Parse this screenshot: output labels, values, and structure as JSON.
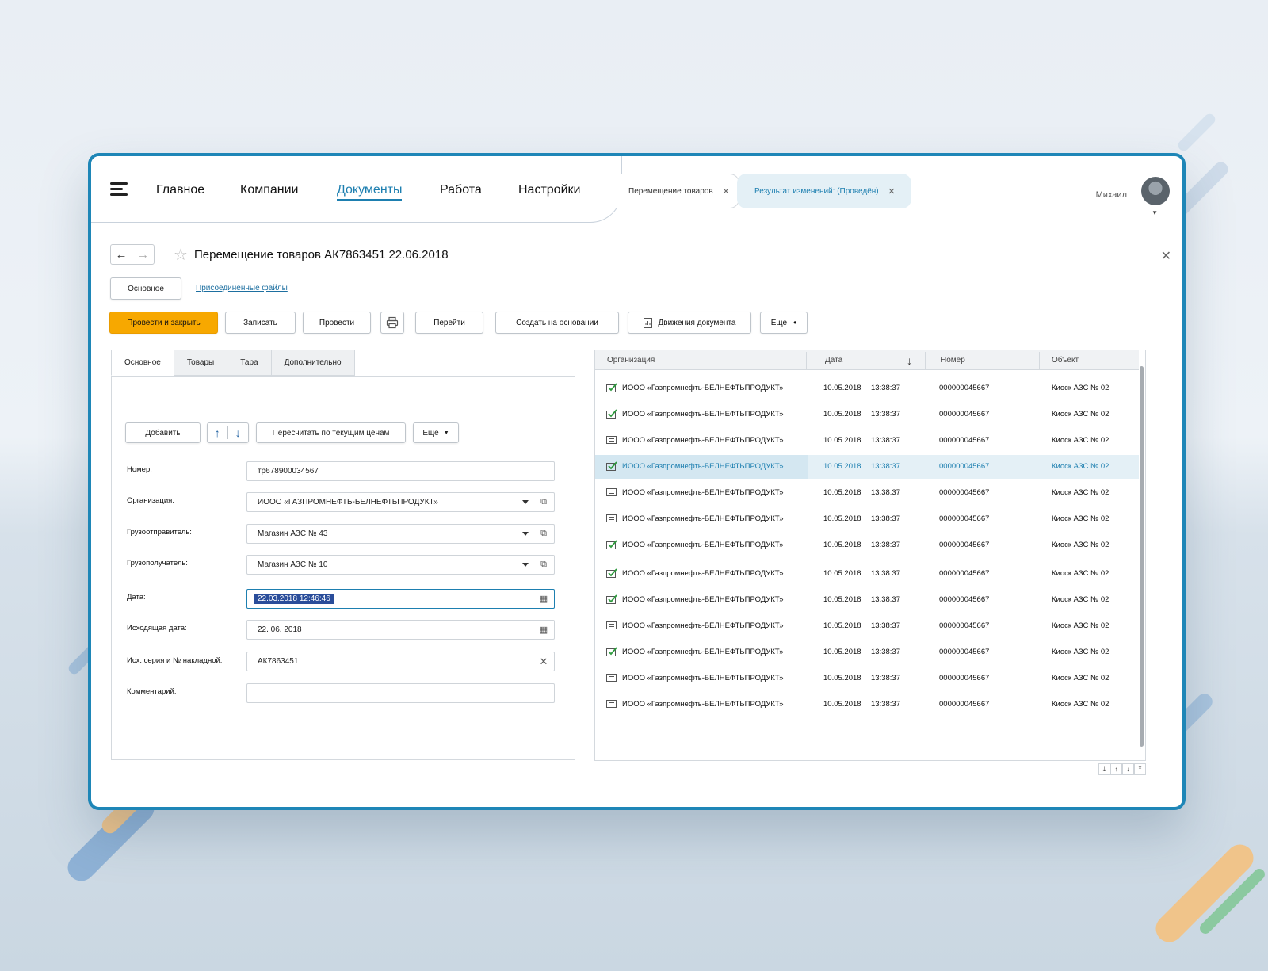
{
  "nav": {
    "items": [
      "Главное",
      "Компании",
      "Документы",
      "Работа",
      "Настройки"
    ],
    "active_index": 2
  },
  "open_tabs": [
    {
      "label": "Перемещение товаров"
    },
    {
      "label": "Результат изменений: (Проведён)"
    }
  ],
  "user": {
    "name": "Михаил"
  },
  "document": {
    "title": "Перемещение товаров АК7863451 22.06.2018",
    "subtabs": [
      "Основное",
      "Присоединенные файлы"
    ]
  },
  "toolbar": {
    "post_close": "Провести и закрыть",
    "save": "Записать",
    "post": "Провести",
    "goto": "Перейти",
    "create_based": "Создать на основании",
    "movements": "Движения документа",
    "more": "Еще"
  },
  "form": {
    "tabs": [
      "Основное",
      "Товары",
      "Тара",
      "Дополнительно"
    ],
    "add_label": "Добавить",
    "recalc_label": "Пересчитать по текущим ценам",
    "more_label": "Еще",
    "fields": {
      "number": {
        "label": "Номер:",
        "value": "тр678900034567"
      },
      "org": {
        "label": "Организация:",
        "value": "ИООО «ГАЗПРОМНЕФТЬ-БЕЛНЕФТЬПРОДУКТ»"
      },
      "shipper": {
        "label": "Грузоотправитель:",
        "value": "Магазин АЗС № 43"
      },
      "consignee": {
        "label": "Грузополучатель:",
        "value": "Магазин АЗС № 10"
      },
      "date": {
        "label": "Дата:",
        "value": "22.03.2018 12:46:46"
      },
      "out_date": {
        "label": "Исходящая дата:",
        "value": "22. 06. 2018"
      },
      "invoice": {
        "label": "Исх. серия и № накладной:",
        "value": "АК7863451"
      },
      "comment": {
        "label": "Комментарий:",
        "value": ""
      }
    }
  },
  "table": {
    "columns": [
      "Организация",
      "Дата",
      "Номер",
      "Объект"
    ],
    "rows": [
      {
        "org": "ИООО «Газпромнефть-БЕЛНЕФТЬПРОДУКТ»",
        "date": "10.05.2018",
        "time": "13:38:37",
        "number": "000000045667",
        "object": "Киоск АЗС № 02",
        "status": "posted"
      },
      {
        "org": "ИООО «Газпромнефть-БЕЛНЕФТЬПРОДУКТ»",
        "date": "10.05.2018",
        "time": "13:38:37",
        "number": "000000045667",
        "object": "Киоск АЗС № 02",
        "status": "posted"
      },
      {
        "org": "ИООО «Газпромнефть-БЕЛНЕФТЬПРОДУКТ»",
        "date": "10.05.2018",
        "time": "13:38:37",
        "number": "000000045667",
        "object": "Киоск АЗС № 02",
        "status": "draft"
      },
      {
        "org": "ИООО «Газпромнефть-БЕЛНЕФТЬПРОДУКТ»",
        "date": "10.05.2018",
        "time": "13:38:37",
        "number": "000000045667",
        "object": "Киоск АЗС № 02",
        "status": "posted",
        "selected": true
      },
      {
        "org": "ИООО «Газпромнефть-БЕЛНЕФТЬПРОДУКТ»",
        "date": "10.05.2018",
        "time": "13:38:37",
        "number": "000000045667",
        "object": "Киоск АЗС № 02",
        "status": "draft"
      },
      {
        "org": "ИООО «Газпромнефть-БЕЛНЕФТЬПРОДУКТ»",
        "date": "10.05.2018",
        "time": "13:38:37",
        "number": "000000045667",
        "object": "Киоск АЗС № 02",
        "status": "draft"
      },
      {
        "org": "ИООО «Газпромнефть-БЕЛНЕФТЬПРОДУКТ»",
        "date": "10.05.2018",
        "time": "13:38:37",
        "number": "000000045667",
        "object": "Киоск АЗС № 02",
        "status": "posted"
      },
      {
        "org": "ИООО «Газпромнефть-БЕЛНЕФТЬПРОДУКТ»",
        "date": "10.05.2018",
        "time": "13:38:37",
        "number": "000000045667",
        "object": "Киоск АЗС № 02",
        "status": "posted"
      },
      {
        "org": "ИООО «Газпромнефть-БЕЛНЕФТЬПРОДУКТ»",
        "date": "10.05.2018",
        "time": "13:38:37",
        "number": "000000045667",
        "object": "Киоск АЗС № 02",
        "status": "posted"
      },
      {
        "org": "ИООО «Газпромнефть-БЕЛНЕФТЬПРОДУКТ»",
        "date": "10.05.2018",
        "time": "13:38:37",
        "number": "000000045667",
        "object": "Киоск АЗС № 02",
        "status": "draft"
      },
      {
        "org": "ИООО «Газпромнефть-БЕЛНЕФТЬПРОДУКТ»",
        "date": "10.05.2018",
        "time": "13:38:37",
        "number": "000000045667",
        "object": "Киоск АЗС № 02",
        "status": "posted"
      },
      {
        "org": "ИООО «Газпромнефть-БЕЛНЕФТЬПРОДУКТ»",
        "date": "10.05.2018",
        "time": "13:38:37",
        "number": "000000045667",
        "object": "Киоск АЗС № 02",
        "status": "draft"
      },
      {
        "org": "ИООО «Газпромнефть-БЕЛНЕФТЬПРОДУКТ»",
        "date": "10.05.2018",
        "time": "13:38:37",
        "number": "000000045667",
        "object": "Киоск АЗС № 02",
        "status": "draft"
      }
    ]
  },
  "colors": {
    "accent": "#1d7fb0",
    "primary_button": "#f7a800",
    "frame": "#1e86b7",
    "selected_row": "#e4f0f6"
  }
}
